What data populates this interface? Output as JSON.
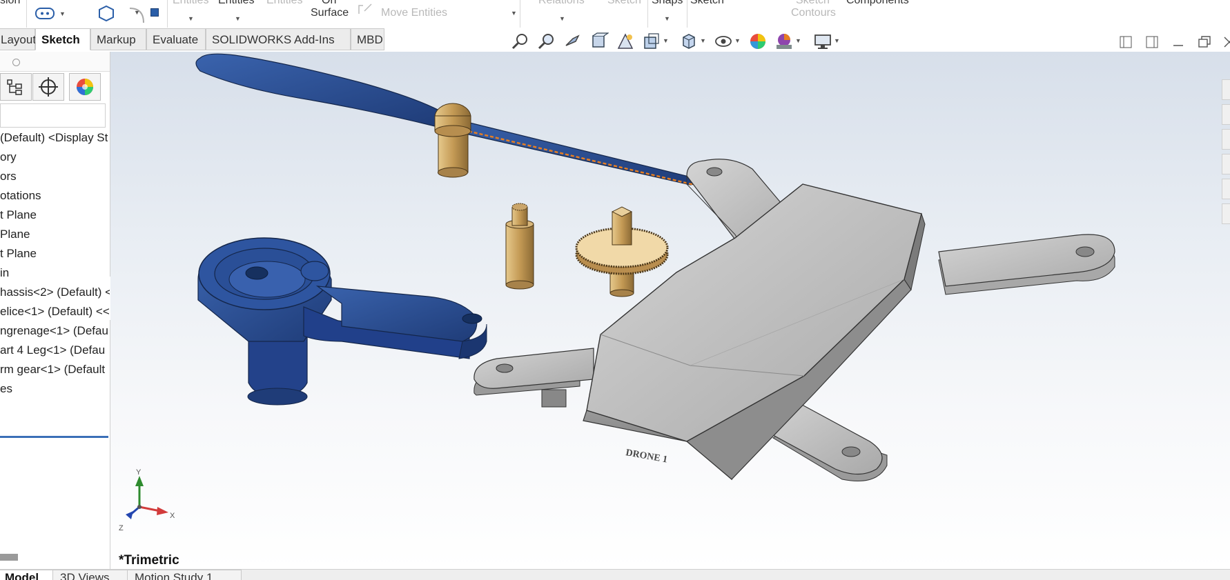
{
  "ribbon": {
    "items": {
      "rb_sion": "sion",
      "entities_a": "Entities",
      "entities_b": "Entities",
      "entities_c": "Entities",
      "on_label": "On",
      "surface_label": "Surface",
      "move_entities": "Move Entities",
      "relations": "Relations",
      "sketch_dim": "Sketch",
      "snaps": "Snaps",
      "sketch": "Sketch",
      "sketch_contours_top": "Sketch",
      "contours": "Contours",
      "components": "Components"
    }
  },
  "tabs": [
    "Layout",
    "Sketch",
    "Markup",
    "Evaluate",
    "SOLIDWORKS Add-Ins",
    "MBD"
  ],
  "active_tab": "Sketch",
  "feature_tree": {
    "items": [
      "(Default) <Display St",
      "ory",
      "ors",
      "otations",
      "t Plane",
      "Plane",
      "t Plane",
      "in",
      "hassis<2> (Default) <",
      "elice<1> (Default) <<",
      "ngrenage<1> (Defau",
      "art 4 Leg<1> (Defau",
      "rm gear<1> (Default",
      "es"
    ]
  },
  "viewport": {
    "view_label": "*Trimetric",
    "triad": {
      "x": "X",
      "y": "Y",
      "z": "Z"
    },
    "engraving": "DRONE 1",
    "colors": {
      "blue_part": "#2c4d8f",
      "brass_part": "#c6a46a",
      "grey_part": "#bdbdbd",
      "accent_orange": "#e67e22"
    }
  },
  "bottom_tabs": [
    "Model",
    "3D Views",
    "Motion Study 1"
  ],
  "active_bottom_tab": "Model"
}
